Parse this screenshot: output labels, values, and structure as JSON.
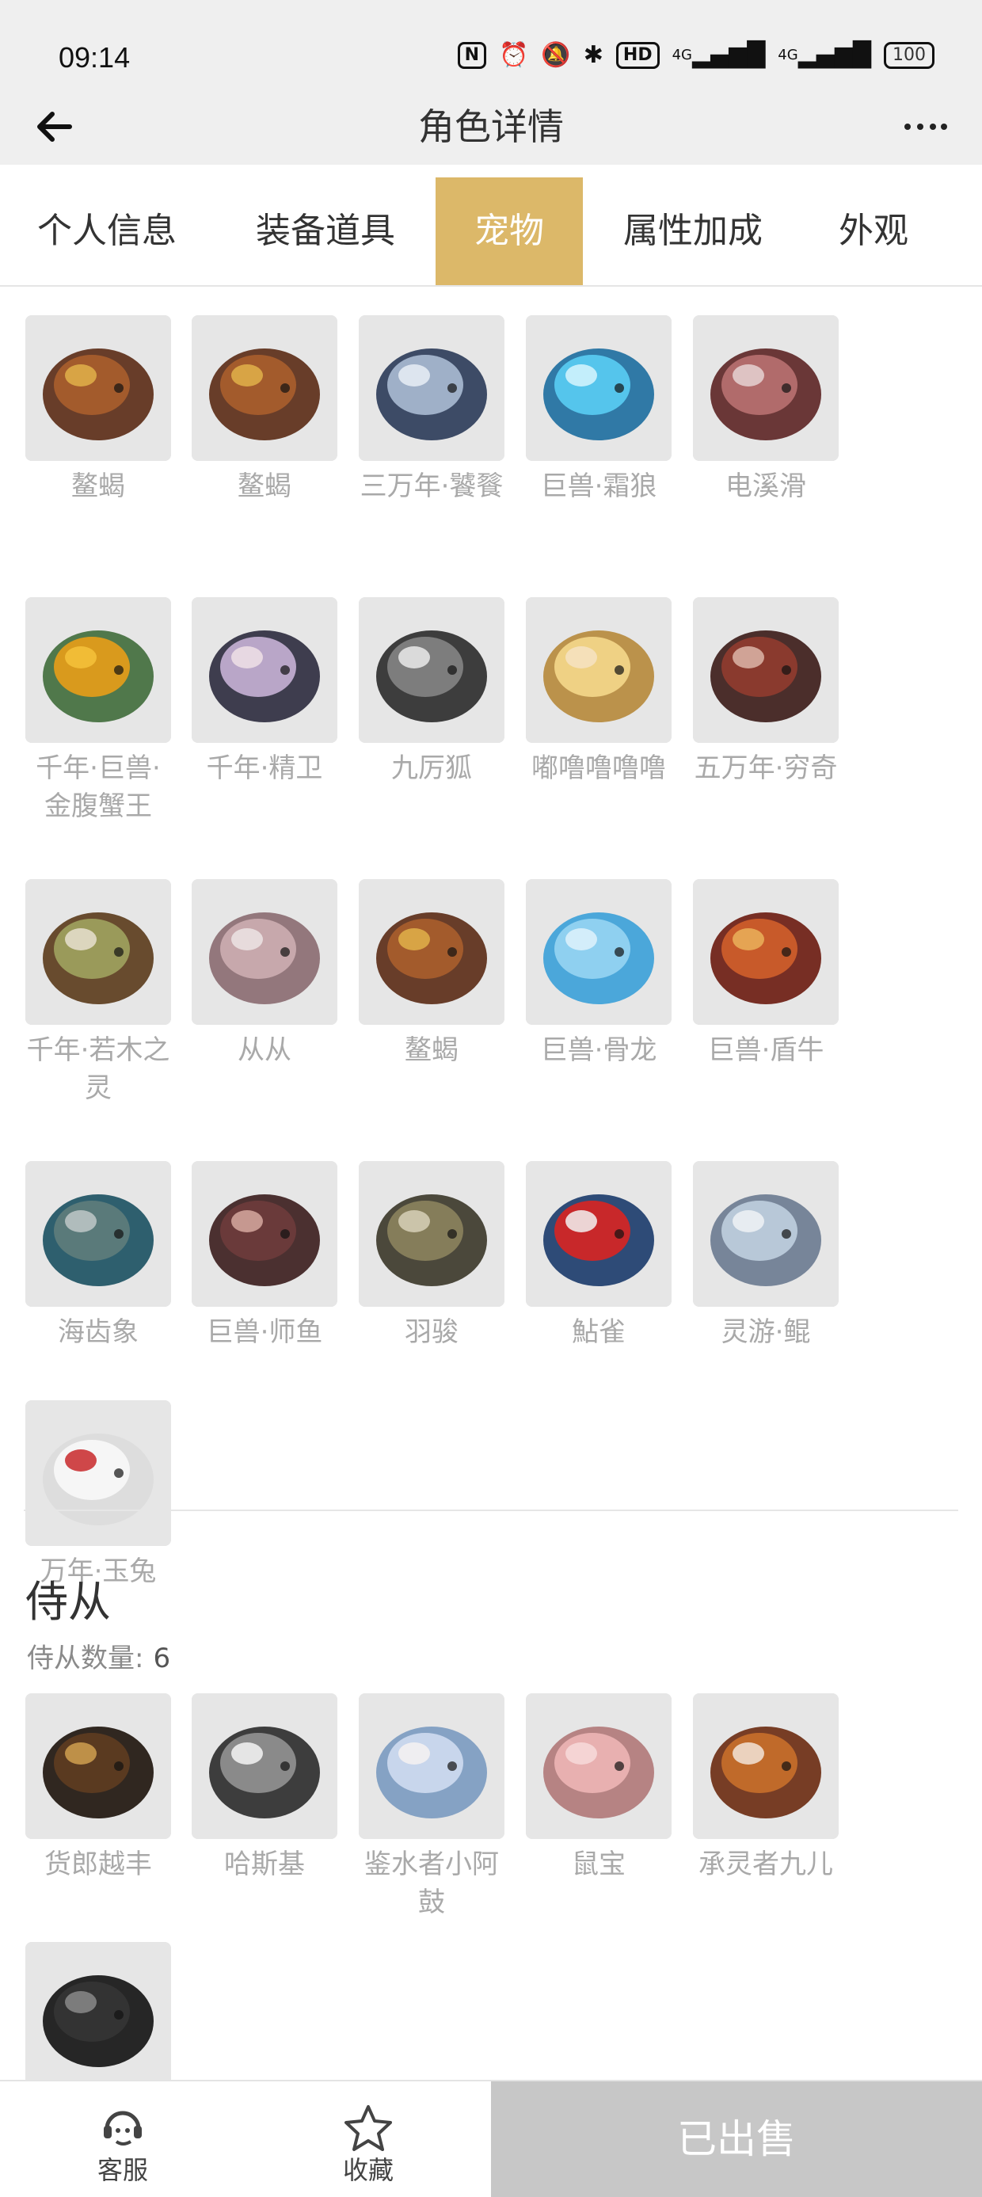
{
  "status": {
    "time": "09:14",
    "icons": [
      "nfc-icon",
      "alarm-icon",
      "mute-icon",
      "bluetooth-icon",
      "hd-icon",
      "signal-4g-icon",
      "signal-4g-icon-2",
      "battery-icon"
    ],
    "hd": "HD",
    "net1": "4G",
    "net2": "4G",
    "battery": "100"
  },
  "header": {
    "title": "角色详情"
  },
  "tabs": [
    {
      "label": "个人信息",
      "active": false
    },
    {
      "label": "装备道具",
      "active": false
    },
    {
      "label": "宠物",
      "active": true
    },
    {
      "label": "属性加成",
      "active": false
    },
    {
      "label": "外观",
      "active": false
    }
  ],
  "pets": [
    {
      "name": "鳌蝎",
      "icon": "scorpion-pet"
    },
    {
      "name": "鳌蝎",
      "icon": "scorpion-pet"
    },
    {
      "name": "三万年·饕餮",
      "icon": "taotie-pet"
    },
    {
      "name": "巨兽·霜狼",
      "icon": "frost-wolf-pet"
    },
    {
      "name": "电溪滑",
      "icon": "electric-eel-pet"
    },
    {
      "name": "千年·巨兽·金腹蟹王",
      "icon": "golden-crab-pet"
    },
    {
      "name": "千年·精卫",
      "icon": "jingwei-pet"
    },
    {
      "name": "九厉狐",
      "icon": "nine-fox-pet"
    },
    {
      "name": "嘟噜噜噜噜",
      "icon": "fairy-girl-pet"
    },
    {
      "name": "五万年·穷奇",
      "icon": "qiongqi-pet"
    },
    {
      "name": "千年·若木之灵",
      "icon": "tree-spirit-pet"
    },
    {
      "name": "从从",
      "icon": "congcong-pet"
    },
    {
      "name": "鳌蝎",
      "icon": "scorpion-pet"
    },
    {
      "name": "巨兽·骨龙",
      "icon": "bone-dragon-pet"
    },
    {
      "name": "巨兽·盾牛",
      "icon": "shield-bull-pet"
    },
    {
      "name": "海齿象",
      "icon": "walrus-pet"
    },
    {
      "name": "巨兽·师鱼",
      "icon": "lion-fish-pet"
    },
    {
      "name": "羽骏",
      "icon": "feather-steed-pet"
    },
    {
      "name": "鮎雀",
      "icon": "bird-pet"
    },
    {
      "name": "灵游·鲲",
      "icon": "kun-fish-pet"
    },
    {
      "name": "万年·玉兔",
      "icon": "jade-rabbit-pet"
    }
  ],
  "attendants": {
    "title": "侍从",
    "count_label": "侍从数量:",
    "count": "6",
    "items": [
      {
        "name": "货郎越丰",
        "icon": "eagle-attendant"
      },
      {
        "name": "哈斯基",
        "icon": "husky-attendant"
      },
      {
        "name": "鉴水者小阿鼓",
        "icon": "chibi-girl-attendant"
      },
      {
        "name": "鼠宝",
        "icon": "rat-attendant"
      },
      {
        "name": "承灵者九儿",
        "icon": "red-panda-attendant"
      },
      {
        "name": "",
        "icon": "shadow-wolf-attendant"
      }
    ]
  },
  "bottom": {
    "service": "客服",
    "favorite": "收藏",
    "sold": "已出售"
  }
}
